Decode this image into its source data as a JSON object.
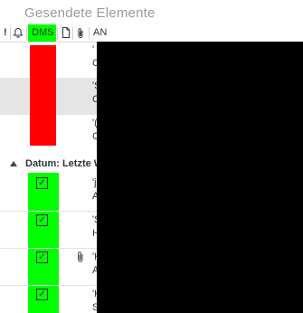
{
  "folder_title": "Gesendete Elemente",
  "header": {
    "importance": "!",
    "reminder_icon": "bell-icon",
    "dms": "DMS",
    "doc_icon": "document-icon",
    "attachment_icon": "paperclip-icon",
    "from": "AN"
  },
  "group": {
    "label": "Datum: Letzte W",
    "icon": "collapse-triangle-icon"
  },
  "upper_rows": [
    {
      "line1": "'",
      "line2": "C"
    },
    {
      "line1": "'S",
      "line2": "C"
    },
    {
      "line1": "'(",
      "line2": "C"
    }
  ],
  "lower_rows": [
    {
      "line1": "'j",
      "line2": "A",
      "checked": "✓"
    },
    {
      "line1": "'S",
      "line2": "H",
      "checked": "✓"
    },
    {
      "line1": "'K",
      "line2": "A",
      "checked": "✓"
    },
    {
      "line1": "'K",
      "line2": "S",
      "checked": "✓"
    }
  ],
  "colors": {
    "dms_highlight": "#00ff00",
    "red_block": "#ff0000",
    "selected_row": "#e5e5e5",
    "redaction": "#000000"
  }
}
